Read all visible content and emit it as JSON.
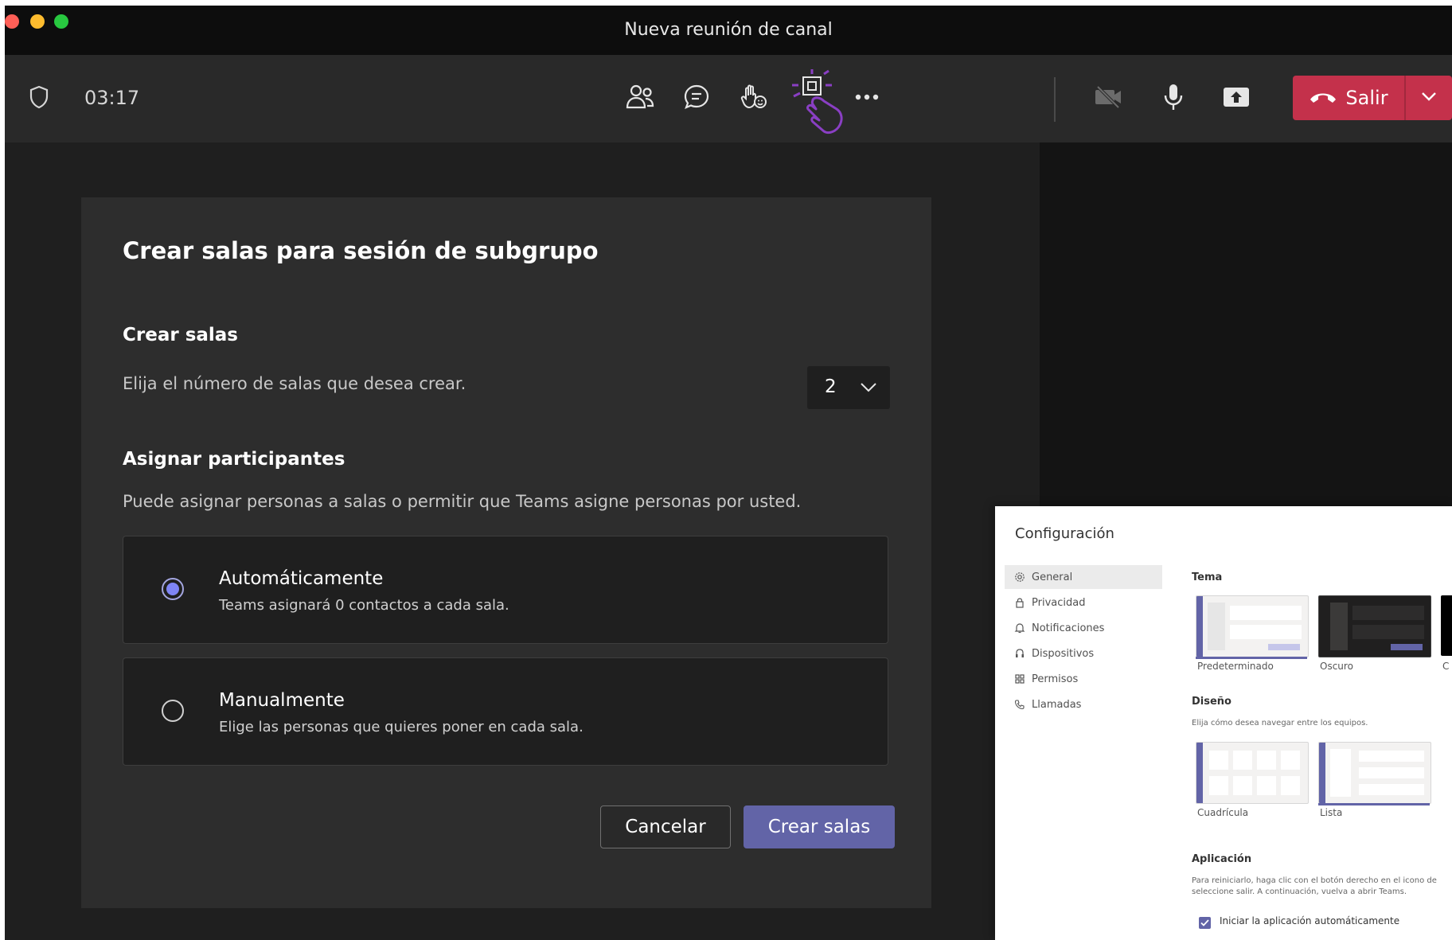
{
  "window": {
    "title": "Nueva reunión de canal",
    "traffic_lights": [
      "#ff5f57",
      "#febc2e",
      "#28c840"
    ]
  },
  "toolbar": {
    "timer": "03:17",
    "icons": [
      "shield-icon",
      "people-icon",
      "chat-icon",
      "raise-hand-icon",
      "breakout-rooms-icon",
      "more-icon",
      "camera-off-icon",
      "microphone-icon",
      "share-icon"
    ],
    "leave_label": "Salir"
  },
  "dialog": {
    "title": "Crear salas para sesión de subgrupo",
    "rooms_title": "Crear salas",
    "rooms_desc": "Elija el número de salas que desea crear.",
    "rooms_count": "2",
    "assign_title": "Asignar participantes",
    "assign_desc": "Puede asignar personas a salas o permitir que Teams asigne personas por usted.",
    "options": [
      {
        "title": "Automáticamente",
        "desc": "Teams asignará 0 contactos a cada sala.",
        "selected": true
      },
      {
        "title": "Manualmente",
        "desc": "Elige las personas que quieres poner en cada sala.",
        "selected": false
      }
    ],
    "cancel_label": "Cancelar",
    "create_label": "Crear salas"
  },
  "settings": {
    "title": "Configuración",
    "nav": [
      {
        "label": "General",
        "icon": "gear-icon"
      },
      {
        "label": "Privacidad",
        "icon": "lock-icon"
      },
      {
        "label": "Notificaciones",
        "icon": "bell-icon"
      },
      {
        "label": "Dispositivos",
        "icon": "headset-icon"
      },
      {
        "label": "Permisos",
        "icon": "grid-icon"
      },
      {
        "label": "Llamadas",
        "icon": "phone-icon"
      }
    ],
    "theme_title": "Tema",
    "themes": [
      "Predeterminado",
      "Oscuro",
      "C"
    ],
    "layout_title": "Diseño",
    "layout_desc": "Elija cómo desea navegar entre los equipos.",
    "layouts": [
      "Cuadrícula",
      "Lista"
    ],
    "app_title": "Aplicación",
    "app_desc_1": "Para reiniciarlo, haga clic con el botón derecho en el icono de",
    "app_desc_2": "seleccione salir. A continuación, vuelva a abrir Teams.",
    "autostart_label": "Iniciar la aplicación automáticamente"
  },
  "colors": {
    "accent": "#6264a7",
    "leave": "#c4314b",
    "annotation": "#8a3fc4"
  }
}
